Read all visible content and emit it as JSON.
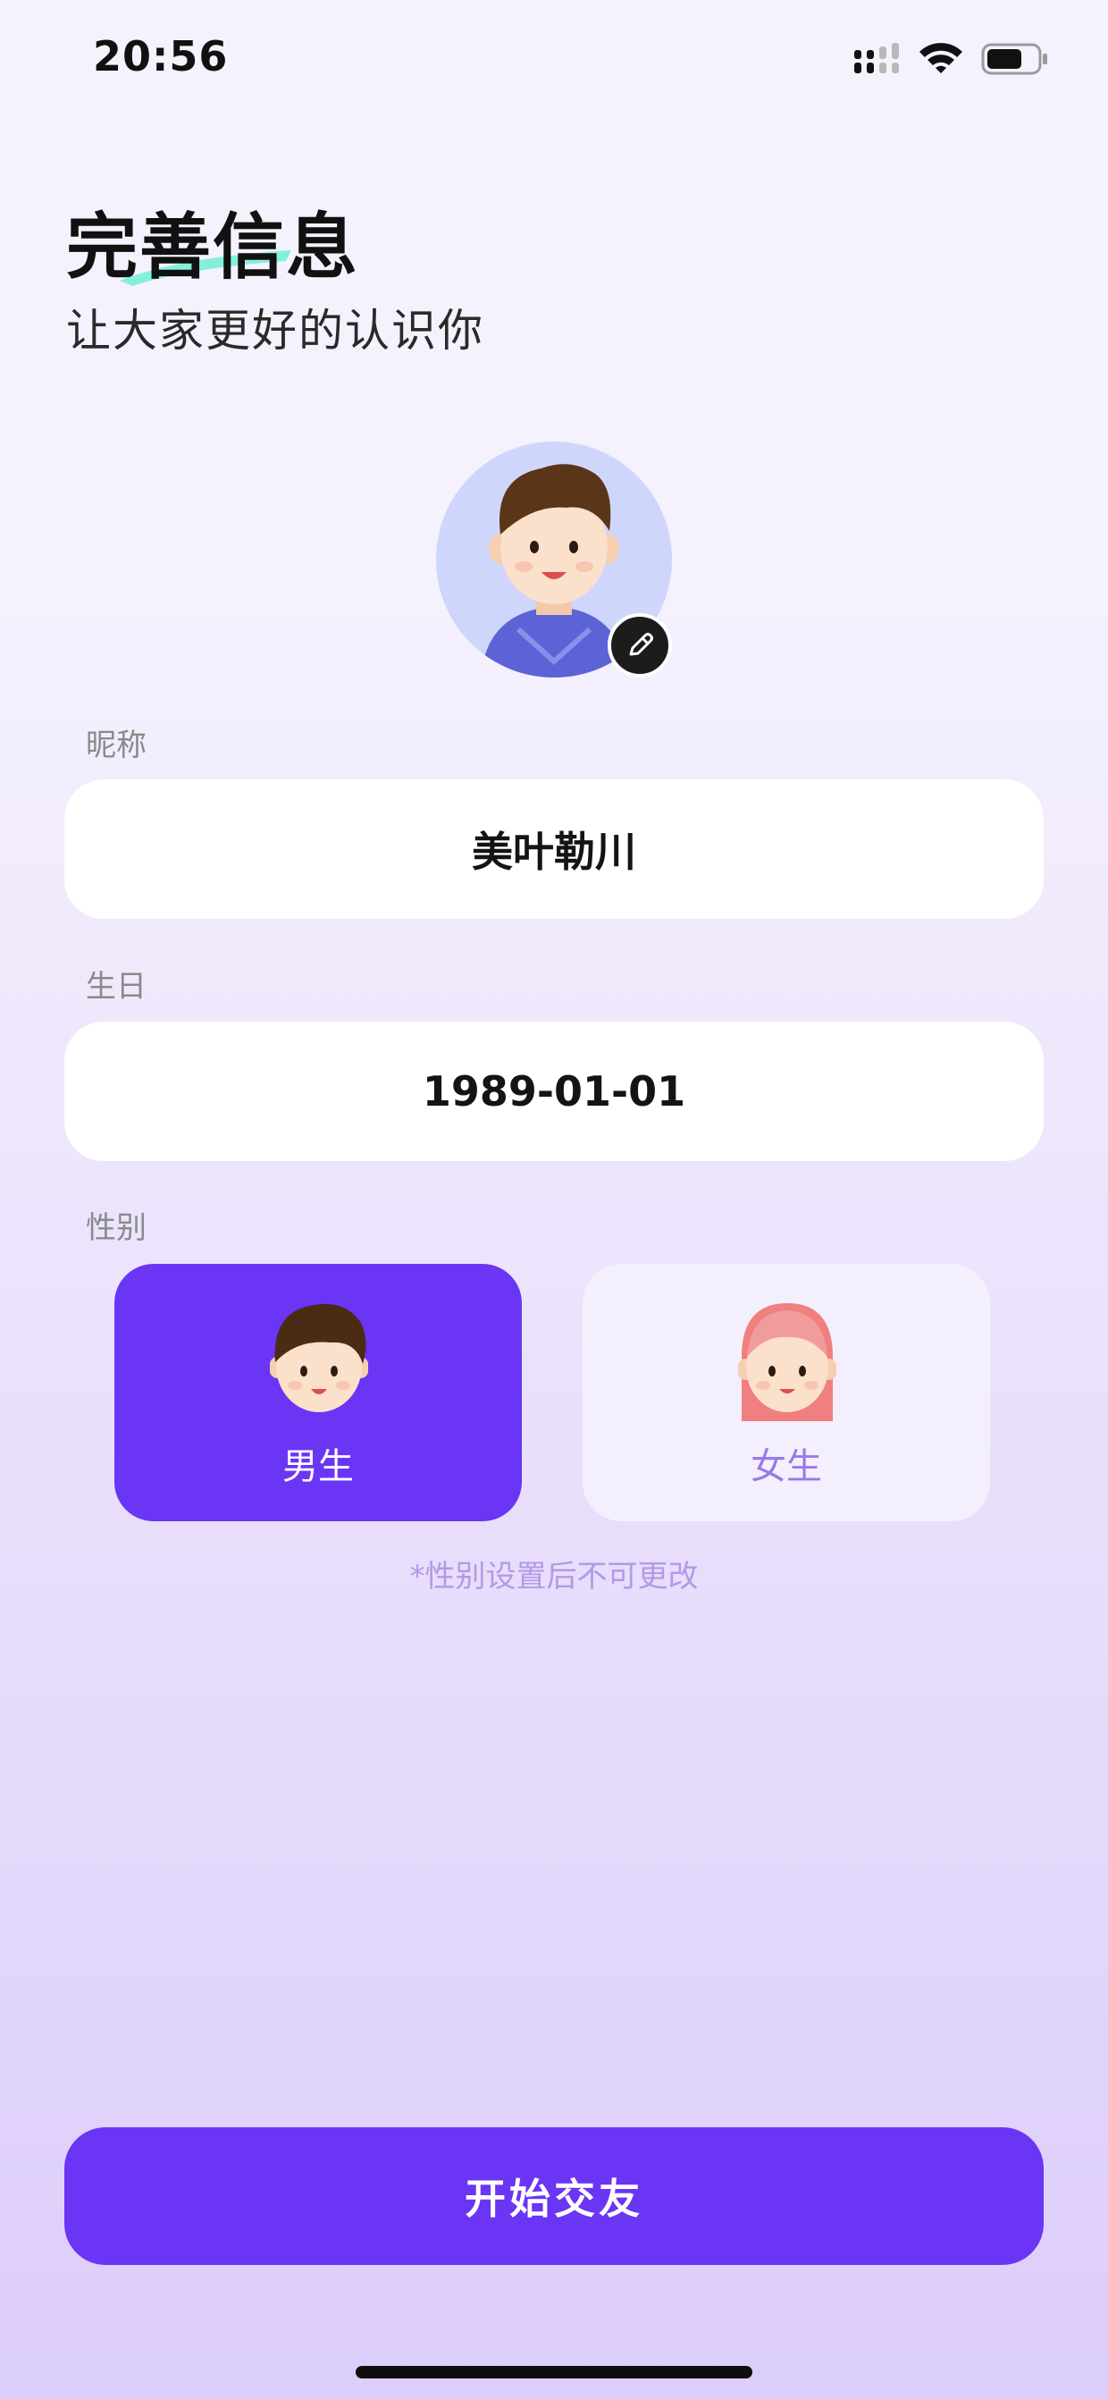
{
  "status_bar": {
    "time": "20:56",
    "signal_icon": "cellular-signal-icon",
    "wifi_icon": "wifi-icon",
    "battery_icon": "battery-icon"
  },
  "header": {
    "title": "完善信息",
    "subtitle": "让大家更好的认识你"
  },
  "avatar": {
    "icon": "boy-avatar-icon",
    "edit_icon": "pencil-icon"
  },
  "form": {
    "nickname_label": "昵称",
    "nickname_value": "美叶勒川",
    "birthday_label": "生日",
    "birthday_value": "1989-01-01",
    "gender_label": "性别",
    "gender_options": [
      {
        "label": "男生",
        "icon": "boy-face-icon",
        "selected": true
      },
      {
        "label": "女生",
        "icon": "girl-face-icon",
        "selected": false
      }
    ],
    "gender_note": "*性别设置后不可更改"
  },
  "actions": {
    "start_label": "开始交友"
  },
  "colors": {
    "accent": "#6a35f4",
    "note": "#b39ae6",
    "female_text": "#9a78e8"
  }
}
